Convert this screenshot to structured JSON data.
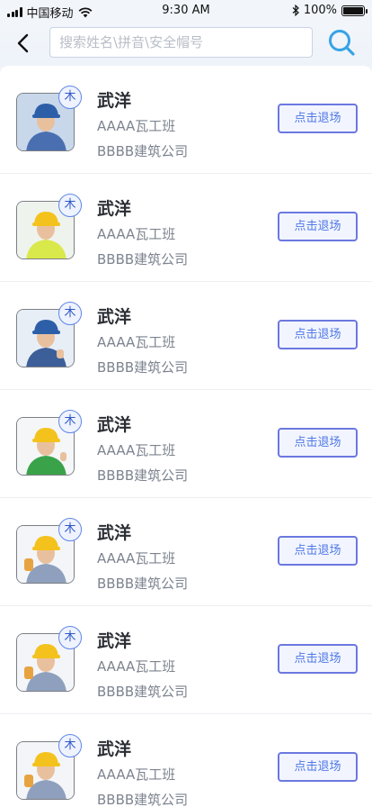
{
  "status_bar": {
    "carrier": "中国移动",
    "time": "9:30 AM",
    "battery": "100%",
    "battery_level": 1.0
  },
  "header": {
    "back_icon": "chevron-left-icon",
    "search_placeholder": "搜索姓名\\拼音\\安全帽号",
    "search_icon": "search-icon"
  },
  "colors": {
    "accent": "#5f86e8",
    "button_border": "#6b78e0",
    "button_text": "#4f78e6",
    "search_icon": "#36a3e6"
  },
  "workers": [
    {
      "name": "武洋",
      "team": "AAAA瓦工班",
      "company": "BBBB建筑公司",
      "badge": "木",
      "action": "点击退场",
      "photo": "worker-blue-helmet"
    },
    {
      "name": "武洋",
      "team": "AAAA瓦工班",
      "company": "BBBB建筑公司",
      "badge": "木",
      "action": "点击退场",
      "photo": "worker-yellow-helmet-vest"
    },
    {
      "name": "武洋",
      "team": "AAAA瓦工班",
      "company": "BBBB建筑公司",
      "badge": "木",
      "action": "点击退场",
      "photo": "worker-blue-cap-thumbs-up"
    },
    {
      "name": "武洋",
      "team": "AAAA瓦工班",
      "company": "BBBB建筑公司",
      "badge": "木",
      "action": "点击退场",
      "photo": "worker-yellow-helmet-overalls"
    },
    {
      "name": "武洋",
      "team": "AAAA瓦工班",
      "company": "BBBB建筑公司",
      "badge": "木",
      "action": "点击退场",
      "photo": "worker-yellow-helmet-glove"
    },
    {
      "name": "武洋",
      "team": "AAAA瓦工班",
      "company": "BBBB建筑公司",
      "badge": "木",
      "action": "点击退场",
      "photo": "worker-yellow-helmet-glove"
    },
    {
      "name": "武洋",
      "team": "AAAA瓦工班",
      "company": "BBBB建筑公司",
      "badge": "木",
      "action": "点击退场",
      "photo": "worker-yellow-helmet-glove"
    }
  ]
}
